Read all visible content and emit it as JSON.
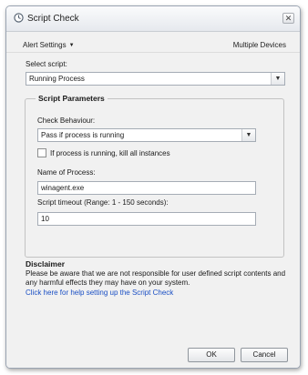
{
  "window": {
    "title": "Script Check",
    "close_glyph": "✕"
  },
  "menubar": {
    "alert_settings": "Alert Settings",
    "multiple_devices": "Multiple Devices"
  },
  "select_script": {
    "label": "Select script:",
    "value": "Running Process"
  },
  "script_parameters": {
    "title": "Script Parameters",
    "check_behaviour_label": "Check Behaviour:",
    "check_behaviour_value": "Pass if process is running",
    "kill_checkbox_label": "If process is running, kill all instances",
    "kill_checkbox_checked": false,
    "process_name_label": "Name of Process:",
    "process_name_value": "winagent.exe",
    "timeout_label": "Script timeout (Range: 1 - 150 seconds):",
    "timeout_value": "10"
  },
  "disclaimer": {
    "title": "Disclaimer",
    "text": "Please be aware that we are not responsible for user defined script contents and any harmful effects they may have on your system.",
    "help_link": "Click here for help setting up the Script Check"
  },
  "buttons": {
    "ok": "OK",
    "cancel": "Cancel"
  }
}
